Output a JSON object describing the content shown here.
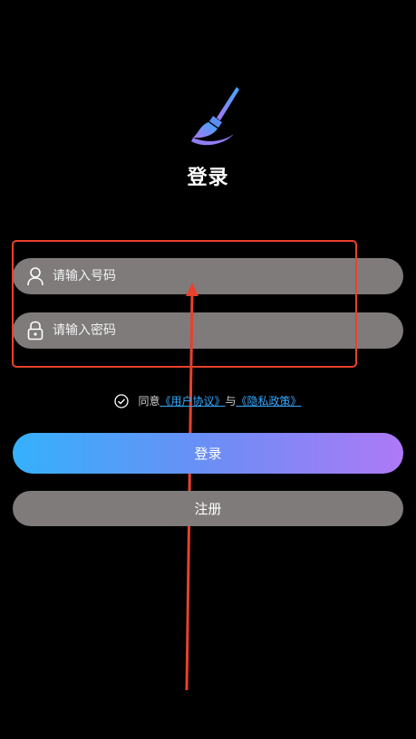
{
  "header": {
    "logo_icon": "paintbrush-icon",
    "title": "登录"
  },
  "form": {
    "phone": {
      "icon": "user-icon",
      "placeholder": "请输入号码",
      "value": ""
    },
    "password": {
      "icon": "lock-icon",
      "placeholder": "请输入密码",
      "value": ""
    }
  },
  "agreement": {
    "check_icon": "check-circle-icon",
    "prefix": "同意",
    "user_agreement": "《用户协议》",
    "conjunction": "与",
    "privacy_policy": "《隐私政策》"
  },
  "buttons": {
    "login": "登录",
    "register": "注册"
  },
  "colors": {
    "background": "#000000",
    "field": "#7f7b7b",
    "link": "#38a8ff",
    "gradient_start": "#35b1fb",
    "gradient_end": "#ae79f6",
    "annotation": "#e8412d"
  }
}
